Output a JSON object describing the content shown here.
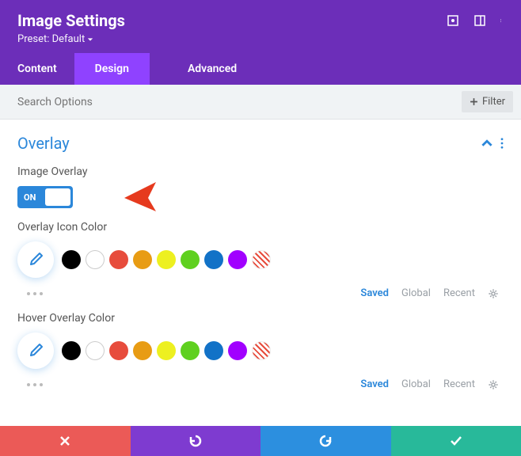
{
  "header": {
    "title": "Image Settings",
    "preset": "Preset: Default"
  },
  "tabs": {
    "content": "Content",
    "design": "Design",
    "advanced": "Advanced"
  },
  "search": {
    "placeholder": "Search Options",
    "filter_label": "Filter"
  },
  "section": {
    "title": "Overlay"
  },
  "fields": {
    "image_overlay_label": "Image Overlay",
    "toggle_on": "ON",
    "overlay_icon_color_label": "Overlay Icon Color",
    "hover_overlay_color_label": "Hover Overlay Color"
  },
  "swatches": {
    "colors": [
      "#000000",
      "#ffffff",
      "#e74c3c",
      "#e89c14",
      "#edf020",
      "#5fd01f",
      "#1272c7",
      "#a100ff",
      "striped"
    ]
  },
  "meta": {
    "saved": "Saved",
    "global": "Global",
    "recent": "Recent"
  }
}
